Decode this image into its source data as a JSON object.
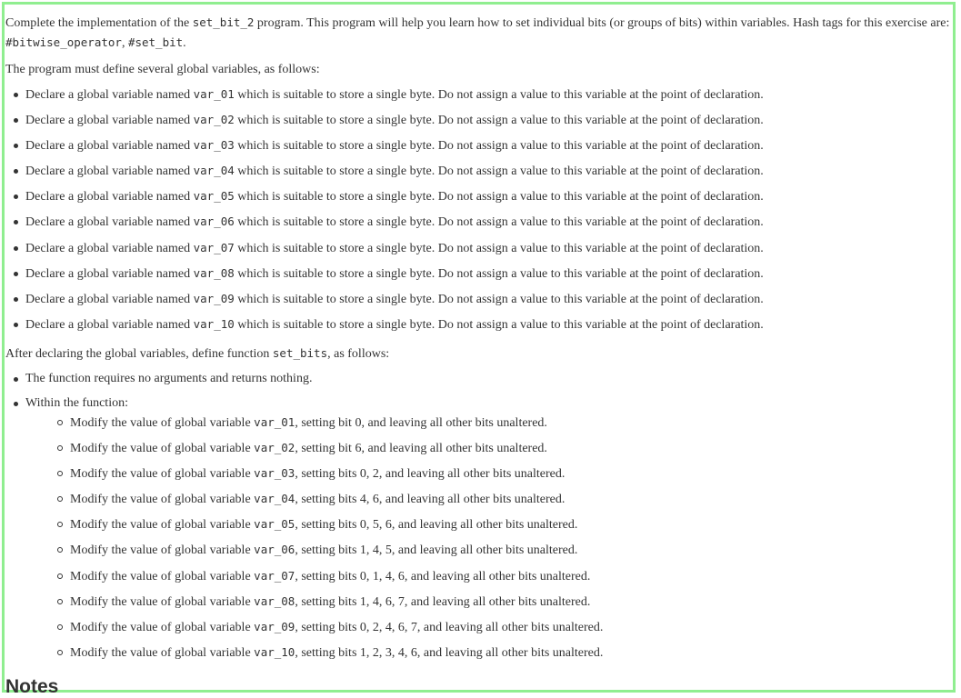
{
  "intro": {
    "before_code": "Complete the implementation of the ",
    "program_name": "set_bit_2",
    "after_code": " program. This program will help you learn how to set individual bits (or groups of bits) within variables. Hash tags for this exercise are: ",
    "tag1": "#bitwise_operator",
    "sep": ", ",
    "tag2": "#set_bit",
    "end": "."
  },
  "globals_heading": "The program must define several global variables, as follows:",
  "globals": [
    {
      "pre": "Declare a global variable named ",
      "code": "var_01",
      "post": " which is suitable to store a single byte. Do not assign a value to this variable at the point of declaration."
    },
    {
      "pre": "Declare a global variable named ",
      "code": "var_02",
      "post": " which is suitable to store a single byte. Do not assign a value to this variable at the point of declaration."
    },
    {
      "pre": "Declare a global variable named ",
      "code": "var_03",
      "post": " which is suitable to store a single byte. Do not assign a value to this variable at the point of declaration."
    },
    {
      "pre": "Declare a global variable named ",
      "code": "var_04",
      "post": " which is suitable to store a single byte. Do not assign a value to this variable at the point of declaration."
    },
    {
      "pre": "Declare a global variable named ",
      "code": "var_05",
      "post": " which is suitable to store a single byte. Do not assign a value to this variable at the point of declaration."
    },
    {
      "pre": "Declare a global variable named ",
      "code": "var_06",
      "post": " which is suitable to store a single byte. Do not assign a value to this variable at the point of declaration."
    },
    {
      "pre": "Declare a global variable named ",
      "code": "var_07",
      "post": " which is suitable to store a single byte. Do not assign a value to this variable at the point of declaration."
    },
    {
      "pre": "Declare a global variable named ",
      "code": "var_08",
      "post": " which is suitable to store a single byte. Do not assign a value to this variable at the point of declaration."
    },
    {
      "pre": "Declare a global variable named ",
      "code": "var_09",
      "post": " which is suitable to store a single byte. Do not assign a value to this variable at the point of declaration."
    },
    {
      "pre": "Declare a global variable named ",
      "code": "var_10",
      "post": " which is suitable to store a single byte. Do not assign a value to this variable at the point of declaration."
    }
  ],
  "after_heading": {
    "pre": "After declaring the global variables, define function ",
    "code": "set_bits",
    "post": ", as follows:"
  },
  "function_items": {
    "first": "The function requires no arguments and returns nothing.",
    "second": "Within the function:"
  },
  "modifications": [
    {
      "pre": "Modify the value of global variable ",
      "code": "var_01",
      "post": ", setting bit 0, and leaving all other bits unaltered."
    },
    {
      "pre": "Modify the value of global variable ",
      "code": "var_02",
      "post": ", setting bit 6, and leaving all other bits unaltered."
    },
    {
      "pre": "Modify the value of global variable ",
      "code": "var_03",
      "post": ", setting bits 0, 2, and leaving all other bits unaltered."
    },
    {
      "pre": "Modify the value of global variable ",
      "code": "var_04",
      "post": ", setting bits 4, 6, and leaving all other bits unaltered."
    },
    {
      "pre": "Modify the value of global variable ",
      "code": "var_05",
      "post": ", setting bits 0, 5, 6, and leaving all other bits unaltered."
    },
    {
      "pre": "Modify the value of global variable ",
      "code": "var_06",
      "post": ", setting bits 1, 4, 5, and leaving all other bits unaltered."
    },
    {
      "pre": "Modify the value of global variable ",
      "code": "var_07",
      "post": ", setting bits 0, 1, 4, 6, and leaving all other bits unaltered."
    },
    {
      "pre": "Modify the value of global variable ",
      "code": "var_08",
      "post": ", setting bits 1, 4, 6, 7, and leaving all other bits unaltered."
    },
    {
      "pre": "Modify the value of global variable ",
      "code": "var_09",
      "post": ", setting bits 0, 2, 4, 6, 7, and leaving all other bits unaltered."
    },
    {
      "pre": "Modify the value of global variable ",
      "code": "var_10",
      "post": ", setting bits 1, 2, 3, 4, 6, and leaving all other bits unaltered."
    }
  ],
  "next_heading": "Notes",
  "colors": {
    "border": "#90ee90",
    "text": "#333333"
  }
}
